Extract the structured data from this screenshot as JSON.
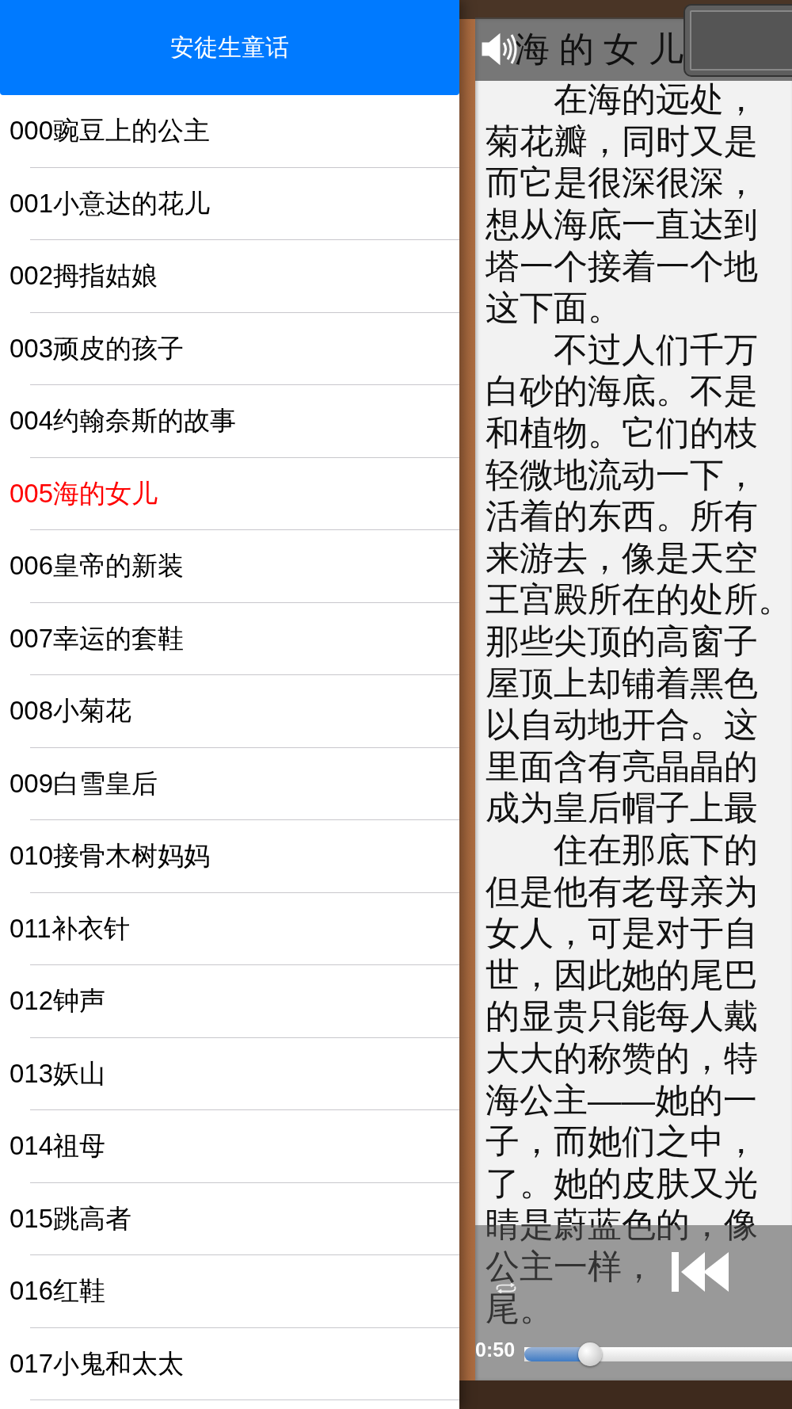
{
  "sidebar": {
    "title": "安徒生童话",
    "items": [
      {
        "label": "000豌豆上的公主",
        "selected": false
      },
      {
        "label": "001小意达的花儿",
        "selected": false
      },
      {
        "label": "002拇指姑娘",
        "selected": false
      },
      {
        "label": "003顽皮的孩子",
        "selected": false
      },
      {
        "label": "004约翰奈斯的故事",
        "selected": false
      },
      {
        "label": "005海的女儿",
        "selected": true
      },
      {
        "label": "006皇帝的新装",
        "selected": false
      },
      {
        "label": "007幸运的套鞋",
        "selected": false
      },
      {
        "label": "008小菊花",
        "selected": false
      },
      {
        "label": "009白雪皇后",
        "selected": false
      },
      {
        "label": "010接骨木树妈妈",
        "selected": false
      },
      {
        "label": "011补衣针",
        "selected": false
      },
      {
        "label": "012钟声",
        "selected": false
      },
      {
        "label": "013妖山",
        "selected": false
      },
      {
        "label": "014祖母",
        "selected": false
      },
      {
        "label": "015跳高者",
        "selected": false
      },
      {
        "label": "016红鞋",
        "selected": false
      },
      {
        "label": "017小鬼和太太",
        "selected": false
      }
    ]
  },
  "reader": {
    "title": "海 的 女 儿",
    "lines": [
      {
        "text": "在海的远处，",
        "indent": true
      },
      {
        "text": "菊花瓣，同时又是",
        "indent": false
      },
      {
        "text": "而它是很深很深，",
        "indent": false
      },
      {
        "text": "想从海底一直达到",
        "indent": false
      },
      {
        "text": "塔一个接着一个地",
        "indent": false
      },
      {
        "text": "这下面。",
        "indent": false
      },
      {
        "text": "不过人们千万",
        "indent": true
      },
      {
        "text": "白砂的海底。不是",
        "indent": false
      },
      {
        "text": "和植物。它们的枝",
        "indent": false
      },
      {
        "text": "轻微地流动一下，",
        "indent": false
      },
      {
        "text": "活着的东西。所有",
        "indent": false
      },
      {
        "text": "来游去，像是天空",
        "indent": false
      },
      {
        "text": "王宫殿所在的处所。",
        "indent": false
      },
      {
        "text": "那些尖顶的高窗子",
        "indent": false
      },
      {
        "text": "屋顶上却铺着黑色",
        "indent": false
      },
      {
        "text": "以自动地开合。这",
        "indent": false
      },
      {
        "text": "里面含有亮晶晶的",
        "indent": false
      },
      {
        "text": "成为皇后帽子上最",
        "indent": false
      },
      {
        "text": "住在那底下的",
        "indent": true
      },
      {
        "text": "但是他有老母亲为",
        "indent": false
      },
      {
        "text": "女人，可是对于自",
        "indent": false
      },
      {
        "text": "世，因此她的尾巴",
        "indent": false
      },
      {
        "text": "的显贵只能每人戴",
        "indent": false
      },
      {
        "text": "大大的称赞的，特",
        "indent": false
      },
      {
        "text": "海公主——她的一",
        "indent": false
      },
      {
        "text": "子，而她们之中，",
        "indent": false
      },
      {
        "text": "了。她的皮肤又光",
        "indent": false
      },
      {
        "text": "睛是蔚蓝色的，像",
        "indent": false
      },
      {
        "text": "公主一样，",
        "indent": false
      },
      {
        "text": "尾。",
        "indent": false
      }
    ]
  },
  "player": {
    "time": "0:50",
    "level": 0.22
  }
}
